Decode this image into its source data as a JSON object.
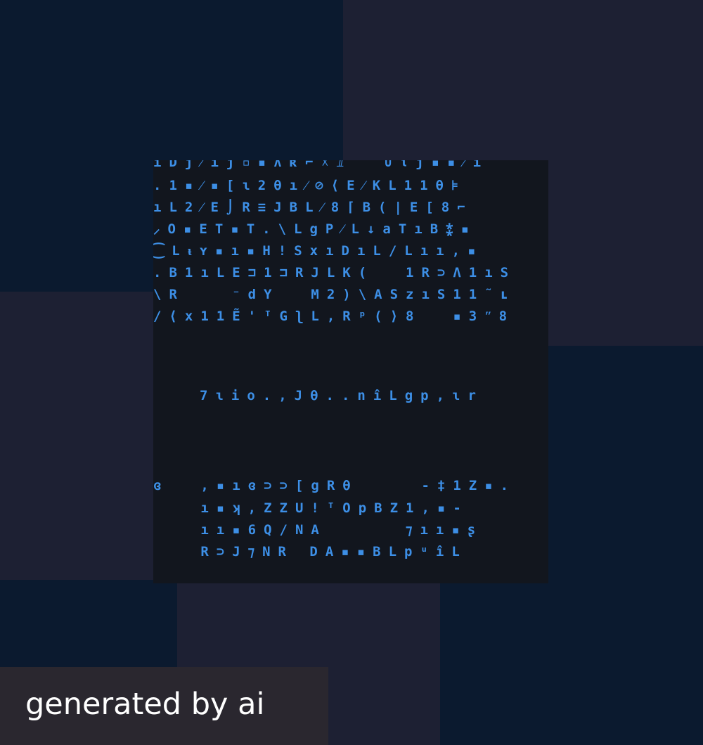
{
  "artwork": {
    "description": "AI-generated abstract pseudo-text pattern",
    "colors": {
      "glyph": "#3d8fe6",
      "panel": "#12161e",
      "tile_navy": "#0b1a2f",
      "tile_slate": "#1d2033",
      "label_bg": "#2a272f",
      "label_text": "#ffffff"
    },
    "upper_block": [
      "ıDj⁄ıȷ▫▪ʌʀ⌐☓ⅈ  ∪ιȷ▪▪⁄ı",
      ".1▪⁄▪[ɩ2θı⁄⊘⟨E⁄KL11θ⊧",
      "ıL2⁄E⌡R≡JBL⁄8⌈B(|E[8⌐",
      "⸝O▪ET▪T.\\LgP⁄L↓aTıB⁑▪",
      "⁐Lᵼʏ▪ı▪H!SxıDıL/Lıı,▪",
      ".B1ıLE⊐1⊐RJLK(  1R⊃Λ1ıS",
      "\\R   ⁻dY  M2)\\ASzıS11˜ʟ",
      "/⟨x11Ẽ'ᵀGʅL,Rᵖ(⟩8  ▪3ʺ8"
    ],
    "middle_line": "7ɩio.,Jθ..nîLgp,ɩr",
    "lower_block": [
      "ɞ  ,▪ıɞ⊃⊃[gRθ    -‡1Z▪.",
      "   ı▪ʞ,ZZU!ᵀOpBZ1,▪-",
      "   ıı▪6Q/NA     ⁊ıı▪ʂ",
      "   R⊃J⁊NR DA▪▪BLpᵘîL"
    ]
  },
  "label": {
    "text": "generated by ai"
  }
}
